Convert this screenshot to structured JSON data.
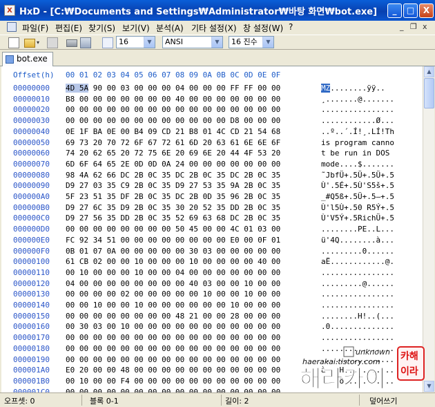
{
  "window": {
    "app_icon_text": "X",
    "title": "HxD - [C:₩Documents and Settings₩Administrator₩바탕 화면₩bot.exe]",
    "minimize_label": "_",
    "maximize_label": "□",
    "close_label": "X"
  },
  "menu": {
    "items": [
      "파일(F)",
      "편집(E)",
      "찾기(S)",
      "보기(V)",
      "분석(A)",
      "기타 설정(X)",
      "창 설정(W)",
      "?"
    ],
    "mdi_min": "_",
    "mdi_restore": "❐",
    "mdi_close": "x"
  },
  "toolbar": {
    "columns_value": "16",
    "charset_value": "ANSI",
    "base_value": "16 진수"
  },
  "tab": {
    "label": "bot.exe"
  },
  "hex_editor": {
    "offset_header": "Offset(h)",
    "column_header": "00 01 02 03 04 05 06 07 08 09 0A 0B 0C 0D 0E 0F",
    "rows": [
      {
        "offset": "00000000",
        "hex_highlight": "4D 5A",
        "hex_rest": " 90 00 03 00 00 00 04 00 00 00 FF FF 00 00",
        "ascii_sel": "MZ",
        "ascii_rest": "........ÿÿ.."
      },
      {
        "offset": "00000010",
        "hex": "B8 00 00 00 00 00 00 00 40 00 00 00 00 00 00 00",
        "ascii": "¸.......@......."
      },
      {
        "offset": "00000020",
        "hex": "00 00 00 00 00 00 00 00 00 00 00 00 00 00 00 00",
        "ascii": "................"
      },
      {
        "offset": "00000030",
        "hex": "00 00 00 00 00 00 00 00 00 00 00 00 D8 00 00 00",
        "ascii": "............Ø..."
      },
      {
        "offset": "00000040",
        "hex": "0E 1F BA 0E 00 B4 09 CD 21 B8 01 4C CD 21 54 68",
        "ascii": "..º..´.Í!¸.LÍ!Th"
      },
      {
        "offset": "00000050",
        "hex": "69 73 20 70 72 6F 67 72 61 6D 20 63 61 6E 6E 6F",
        "ascii": "is program canno"
      },
      {
        "offset": "00000060",
        "hex": "74 20 62 65 20 72 75 6E 20 69 6E 20 44 4F 53 20",
        "ascii": "t be run in DOS "
      },
      {
        "offset": "00000070",
        "hex": "6D 6F 64 65 2E 0D 0D 0A 24 00 00 00 00 00 00 00",
        "ascii": "mode....$......."
      },
      {
        "offset": "00000080",
        "hex": "98 4A 62 66 DC 2B 0C 35 DC 2B 0C 35 DC 2B 0C 35",
        "ascii": "˜JbfÜ+.5Ü+.5Ü+.5"
      },
      {
        "offset": "00000090",
        "hex": "D9 27 03 35 C9 2B 0C 35 D9 27 53 35 9A 2B 0C 35",
        "ascii": "Ù'.5É+.5Ù'S5š+.5"
      },
      {
        "offset": "000000A0",
        "hex": "5F 23 51 35 DF 2B 0C 35 DC 2B 0D 35 96 2B 0C 35",
        "ascii": "_#Q5ß+.5Ü+.5–+.5"
      },
      {
        "offset": "000000B0",
        "hex": "D9 27 6C 35 D9 2B 0C 35 30 20 52 35 DD 2B 0C 35",
        "ascii": "Ù'l5Ù+.50 R5Ý+.5"
      },
      {
        "offset": "000000C0",
        "hex": "D9 27 56 35 DD 2B 0C 35 52 69 63 68 DC 2B 0C 35",
        "ascii": "Ù'V5Ý+.5RichÜ+.5"
      },
      {
        "offset": "000000D0",
        "hex": "00 00 00 00 00 00 00 00 50 45 00 00 4C 01 03 00",
        "ascii": "........PE..L..."
      },
      {
        "offset": "000000E0",
        "hex": "FC 92 34 51 00 00 00 00 00 00 00 00 E0 00 0F 01",
        "ascii": "ü'4Q........à..."
      },
      {
        "offset": "000000F0",
        "hex": "0B 01 07 0A 00 00 00 00 00 30 03 00 00 00 00 00",
        "ascii": ".........0......"
      },
      {
        "offset": "00000100",
        "hex": "61 CB 02 00 00 10 00 00 00 10 00 00 00 00 40 00",
        "ascii": "aË............@."
      },
      {
        "offset": "00000110",
        "hex": "00 10 00 00 00 10 00 00 04 00 00 00 00 00 00 00",
        "ascii": "................"
      },
      {
        "offset": "00000120",
        "hex": "04 00 00 00 00 00 00 00 00 40 03 00 00 10 00 00",
        "ascii": ".........@......"
      },
      {
        "offset": "00000130",
        "hex": "00 00 00 00 02 00 00 00 00 00 10 00 00 10 00 00",
        "ascii": "................"
      },
      {
        "offset": "00000140",
        "hex": "00 00 10 00 00 10 00 00 00 00 00 00 10 00 00 00",
        "ascii": "................"
      },
      {
        "offset": "00000150",
        "hex": "00 00 00 00 00 00 00 00 48 21 00 00 28 00 00 00",
        "ascii": "........H!..(..."
      },
      {
        "offset": "00000160",
        "hex": "00 30 03 00 10 00 00 00 00 00 00 00 00 00 00 00",
        "ascii": ".0.............."
      },
      {
        "offset": "00000170",
        "hex": "00 00 00 00 00 00 00 00 00 00 00 00 00 00 00 00",
        "ascii": "................"
      },
      {
        "offset": "00000180",
        "hex": "00 00 00 00 00 00 00 00 00 00 00 00 00 00 00 00",
        "ascii": "................"
      },
      {
        "offset": "00000190",
        "hex": "00 00 00 00 00 00 00 00 00 00 00 00 00 00 00 00",
        "ascii": "................"
      },
      {
        "offset": "000001A0",
        "hex": "E0 20 00 00 48 00 00 00 00 00 00 00 00 00 00 00",
        "ascii": "à ..H..........."
      },
      {
        "offset": "000001B0",
        "hex": "00 10 00 00 F4 00 00 00 00 00 00 00 00 00 00 00",
        "ascii": "....ô..........."
      },
      {
        "offset": "000001C0",
        "hex": "00 00 00 00 00 00 00 00 00 00 00 00 00 00 00 00",
        "ascii": "................"
      }
    ]
  },
  "statusbar": {
    "offset_text": "오프셋: 0",
    "block_text": "블록 0-1",
    "length_text": "길이: 2",
    "mode_text": "덮어쓰기"
  },
  "watermark": {
    "line1": "unknown",
    "line2": "haerakai.tistory.com",
    "big_text": "해라카이",
    "stamp_top": "카해",
    "stamp_bottom": "이라"
  }
}
